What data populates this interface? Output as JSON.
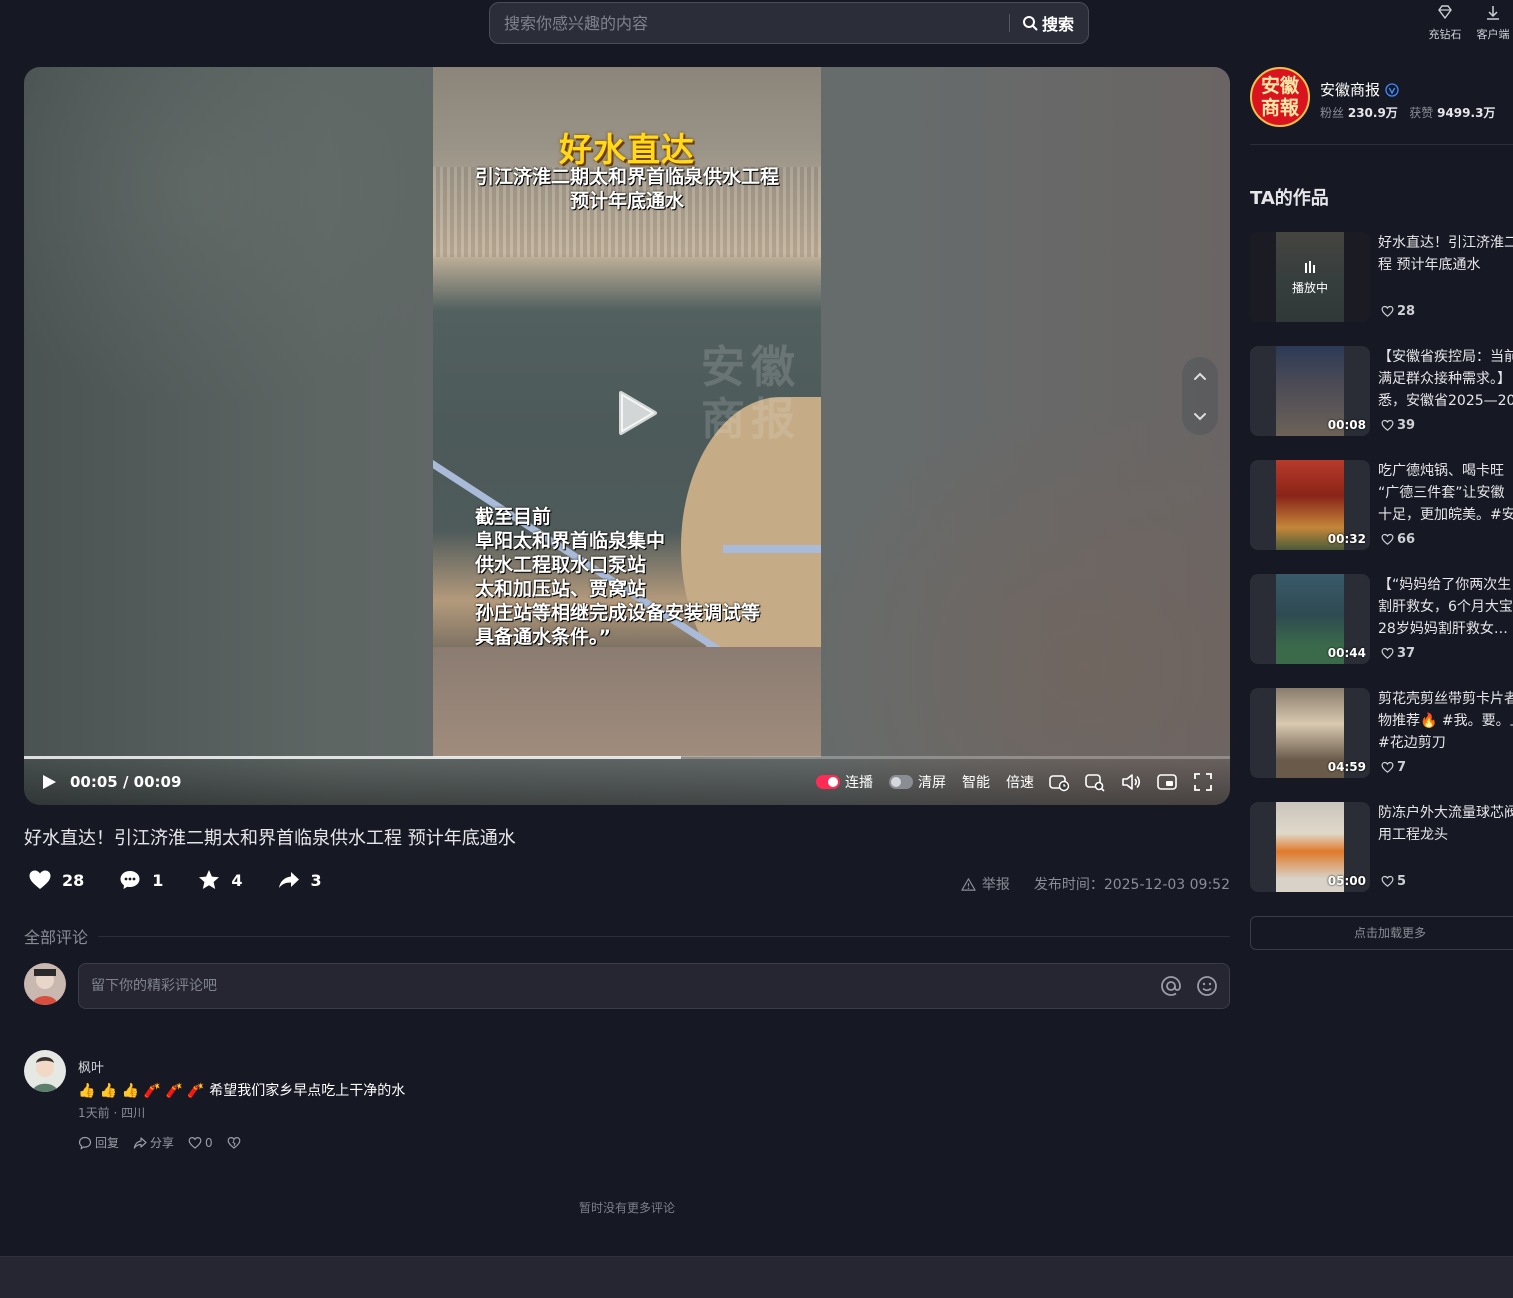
{
  "header": {
    "search_placeholder": "搜索你感兴趣的内容",
    "search_button": "搜索",
    "recharge_label": "充钻石",
    "client_label": "客户端"
  },
  "video": {
    "overlay_title": "好水直达",
    "overlay_sub_line1": "引江济淮二期太和界首临泉供水工程",
    "overlay_sub_line2": "预计年底通水",
    "overlay_body": [
      "截至目前",
      "阜阳太和界首临泉集中",
      "供水工程取水口泵站",
      "太和加压站、贾窝站",
      "孙庄站等相继完成设备安装调试等",
      "具备通水条件。”"
    ],
    "watermark_line1": "安徽",
    "watermark_line2": "商报",
    "progress_fraction": 0.545,
    "time_display": "00:05 / 00:09",
    "autoplay_label": "连播",
    "clear_label": "清屏",
    "smart_label": "智能",
    "speed_label": "倍速"
  },
  "post": {
    "title": "好水直达！引江济淮二期太和界首临泉供水工程 预计年底通水",
    "likes": "28",
    "comments": "1",
    "favorites": "4",
    "shares": "3",
    "report_label": "举报",
    "publish_time": "发布时间：2025-12-03 09:52"
  },
  "comments": {
    "header": "全部评论",
    "input_placeholder": "留下你的精彩评论吧",
    "items": [
      {
        "user": "枫叶",
        "text": "👍 👍 👍 🧨 🧨 🧨 希望我们家乡早点吃上干净的水",
        "time": "1天前 · 四川",
        "reply_label": "回复",
        "share_label": "分享",
        "like_count": "0"
      }
    ],
    "no_more": "暂时没有更多评论"
  },
  "author": {
    "avatar_text": "安徽商報",
    "name": "安徽商报",
    "fans_label": "粉丝",
    "fans": "230.9万",
    "likes_label": "获赞",
    "likes": "9499.3万"
  },
  "works": {
    "title": "TA的作品",
    "playing_label": "播放中",
    "load_more": "点击加载更多",
    "items": [
      {
        "line1": "好水直达！引江济淮二",
        "line2": "程 预计年底通水",
        "line3": "",
        "likes": "28",
        "duration": "",
        "playing": true
      },
      {
        "line1": "【安徽省疾控局：当前",
        "line2": "满足群众接种需求。】",
        "line3": "悉，安徽省2025—20",
        "likes": "39",
        "duration": "00:08",
        "playing": false
      },
      {
        "line1": "吃广德炖锅、喝卡旺",
        "line2": "“广德三件套”让安徽",
        "line3": "十足，更加皖美。#安",
        "likes": "66",
        "duration": "00:32",
        "playing": false
      },
      {
        "line1": "【“妈妈给了你两次生",
        "line2": "割肝救女，6个月大宝",
        "line3": "28岁妈妈割肝救女…",
        "likes": "37",
        "duration": "00:44",
        "playing": false
      },
      {
        "line1": "剪花壳剪丝带剪卡片者",
        "line2": "物推荐🔥 #我。要。上。",
        "line3": "#花边剪刀",
        "likes": "7",
        "duration": "04:59",
        "playing": false
      },
      {
        "line1": "防冻户外大流量球芯阀",
        "line2": "用工程龙头",
        "line3": "",
        "likes": "5",
        "duration": "05:00",
        "playing": false
      }
    ]
  },
  "colors": {
    "background": "#161823",
    "accent": "#fe2c55",
    "overlay_title": "#ffd91a"
  }
}
